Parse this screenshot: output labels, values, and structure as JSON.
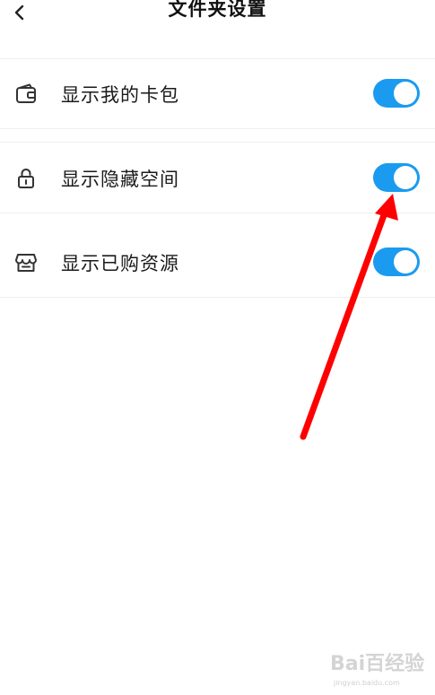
{
  "header": {
    "title": "文件夹设置",
    "back_icon": "chevron-left-icon"
  },
  "settings": [
    {
      "label": "显示我的卡包",
      "icon": "wallet-icon",
      "enabled": true
    },
    {
      "label": "显示隐藏空间",
      "icon": "lock-icon",
      "enabled": true
    },
    {
      "label": "显示已购资源",
      "icon": "shop-icon",
      "enabled": true
    }
  ],
  "colors": {
    "toggle_on": "#1a9bf0",
    "annotation_arrow": "#ff0000"
  },
  "watermark": {
    "logo_text": "Bai百经验",
    "url": "jingyan.baidu.com"
  }
}
